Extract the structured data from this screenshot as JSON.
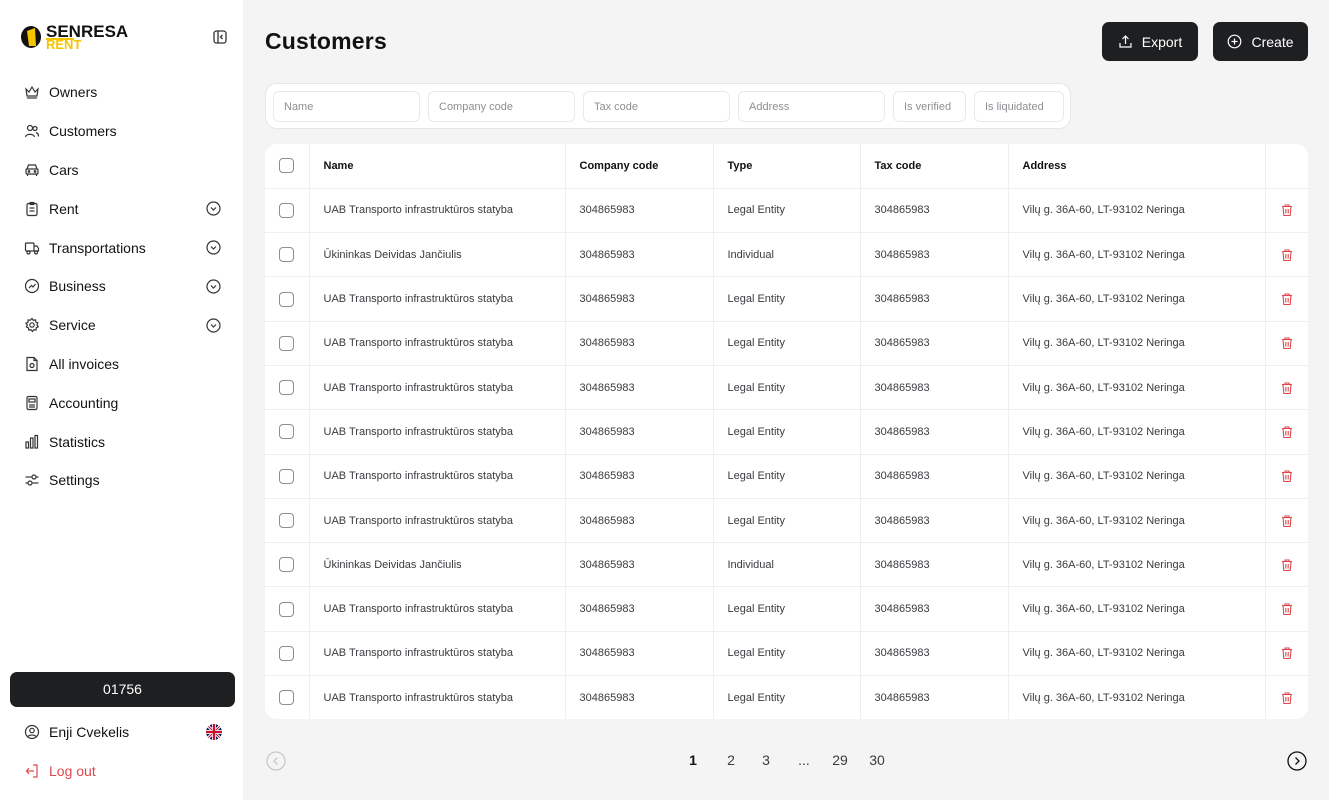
{
  "brand": {
    "name_top": "SENRESA",
    "name_bottom": "RENT"
  },
  "sidebar": {
    "items": [
      {
        "label": "Owners",
        "icon": "crown-icon",
        "expandable": false
      },
      {
        "label": "Customers",
        "icon": "users-icon",
        "expandable": false
      },
      {
        "label": "Cars",
        "icon": "car-icon",
        "expandable": false
      },
      {
        "label": "Rent",
        "icon": "clipboard-icon",
        "expandable": true
      },
      {
        "label": "Transportations",
        "icon": "truck-icon",
        "expandable": true
      },
      {
        "label": "Business",
        "icon": "gauge-icon",
        "expandable": true
      },
      {
        "label": "Service",
        "icon": "gear-icon",
        "expandable": true
      },
      {
        "label": "All invoices",
        "icon": "invoice-icon",
        "expandable": false
      },
      {
        "label": "Accounting",
        "icon": "accounting-icon",
        "expandable": false
      },
      {
        "label": "Statistics",
        "icon": "bar-chart-icon",
        "expandable": false
      },
      {
        "label": "Settings",
        "icon": "sliders-icon",
        "expandable": false
      }
    ],
    "account_code": "01756",
    "user_name": "Enji Cvekelis",
    "language_flag": "uk-flag-icon",
    "logout_label": "Log out",
    "logout_color": "#e0474c"
  },
  "page": {
    "title": "Customers",
    "export_label": "Export",
    "create_label": "Create"
  },
  "filters": {
    "name_placeholder": "Name",
    "company_code_placeholder": "Company code",
    "tax_code_placeholder": "Tax code",
    "address_placeholder": "Address",
    "is_verified_placeholder": "Is verified",
    "is_liquidated_placeholder": "Is liquidated"
  },
  "table": {
    "columns": [
      "Name",
      "Company code",
      "Type",
      "Tax code",
      "Address"
    ],
    "rows": [
      {
        "name": "UAB Transporto infrastruktūros statyba",
        "company_code": "304865983",
        "type": "Legal Entity",
        "tax_code": "304865983",
        "address": "Vilų g. 36A-60, LT-93102 Neringa"
      },
      {
        "name": "Ūkininkas Deividas Jančiulis",
        "company_code": "304865983",
        "type": "Individual",
        "tax_code": "304865983",
        "address": "Vilų g. 36A-60, LT-93102 Neringa"
      },
      {
        "name": "UAB Transporto infrastruktūros statyba",
        "company_code": "304865983",
        "type": "Legal Entity",
        "tax_code": "304865983",
        "address": "Vilų g. 36A-60, LT-93102 Neringa"
      },
      {
        "name": "UAB Transporto infrastruktūros statyba",
        "company_code": "304865983",
        "type": "Legal Entity",
        "tax_code": "304865983",
        "address": "Vilų g. 36A-60, LT-93102 Neringa"
      },
      {
        "name": "UAB Transporto infrastruktūros statyba",
        "company_code": "304865983",
        "type": "Legal Entity",
        "tax_code": "304865983",
        "address": "Vilų g. 36A-60, LT-93102 Neringa"
      },
      {
        "name": "UAB Transporto infrastruktūros statyba",
        "company_code": "304865983",
        "type": "Legal Entity",
        "tax_code": "304865983",
        "address": "Vilų g. 36A-60, LT-93102 Neringa"
      },
      {
        "name": "UAB Transporto infrastruktūros statyba",
        "company_code": "304865983",
        "type": "Legal Entity",
        "tax_code": "304865983",
        "address": "Vilų g. 36A-60, LT-93102 Neringa"
      },
      {
        "name": "UAB Transporto infrastruktūros statyba",
        "company_code": "304865983",
        "type": "Legal Entity",
        "tax_code": "304865983",
        "address": "Vilų g. 36A-60, LT-93102 Neringa"
      },
      {
        "name": "Ūkininkas Deividas Jančiulis",
        "company_code": "304865983",
        "type": "Individual",
        "tax_code": "304865983",
        "address": "Vilų g. 36A-60, LT-93102 Neringa"
      },
      {
        "name": "UAB Transporto infrastruktūros statyba",
        "company_code": "304865983",
        "type": "Legal Entity",
        "tax_code": "304865983",
        "address": "Vilų g. 36A-60, LT-93102 Neringa"
      },
      {
        "name": "UAB Transporto infrastruktūros statyba",
        "company_code": "304865983",
        "type": "Legal Entity",
        "tax_code": "304865983",
        "address": "Vilų g. 36A-60, LT-93102 Neringa"
      },
      {
        "name": "UAB Transporto infrastruktūros statyba",
        "company_code": "304865983",
        "type": "Legal Entity",
        "tax_code": "304865983",
        "address": "Vilų g. 36A-60, LT-93102 Neringa"
      }
    ],
    "delete_icon_color": "#e0474c"
  },
  "pagination": {
    "pages": [
      "1",
      "2",
      "3",
      "...",
      "29",
      "30"
    ],
    "current": "1"
  },
  "colors": {
    "brand_yellow": "#f5c400",
    "dark_button": "#1e1f21",
    "danger": "#e0474c"
  }
}
